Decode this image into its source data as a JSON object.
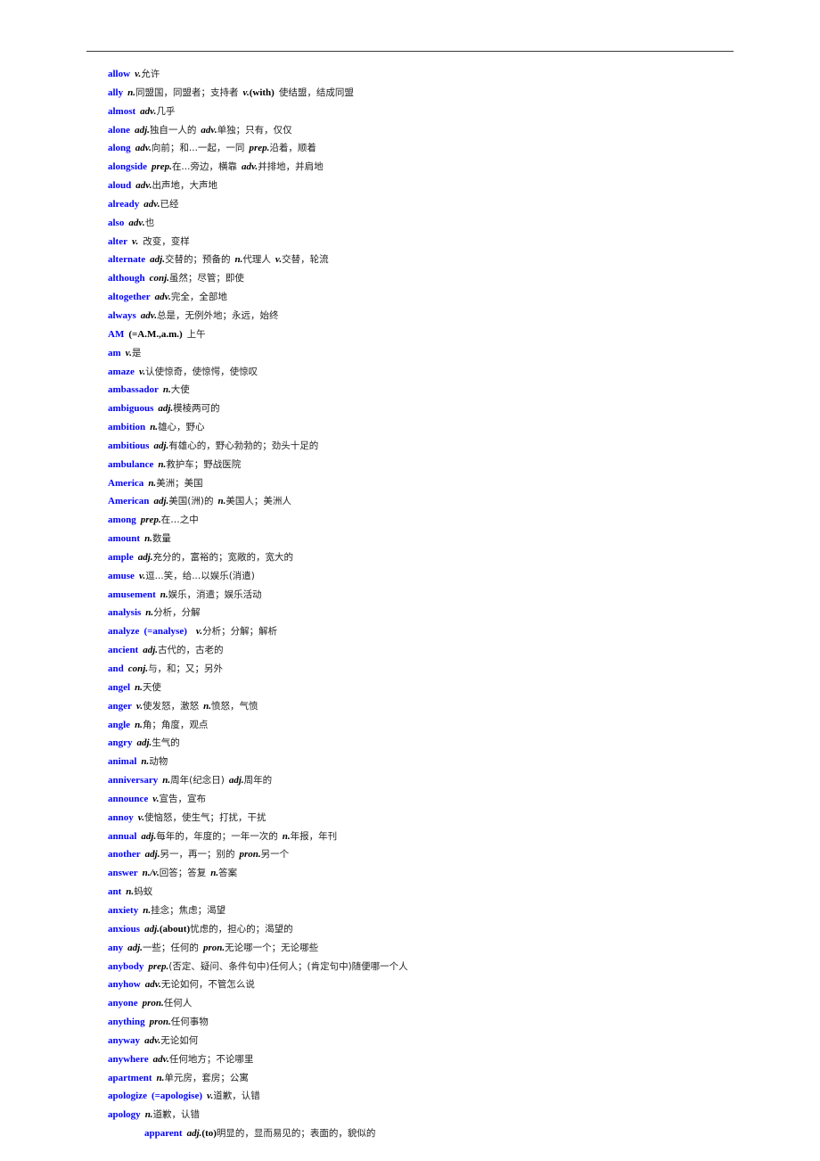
{
  "document": {
    "entries": [
      {
        "word": "allow",
        "parts": [
          {
            "t": "pos",
            "v": "v."
          },
          {
            "t": "def",
            "v": "允许"
          }
        ]
      },
      {
        "word": "ally",
        "parts": [
          {
            "t": "pos",
            "v": "n."
          },
          {
            "t": "def",
            "v": "同盟国，同盟者；支持者"
          },
          {
            "t": "gap"
          },
          {
            "t": "pos",
            "v": "v."
          },
          {
            "t": "note",
            "v": "(with)"
          },
          {
            "t": "gap"
          },
          {
            "t": "def",
            "v": "使结盟，结成同盟"
          }
        ]
      },
      {
        "word": "almost",
        "parts": [
          {
            "t": "pos",
            "v": "adv."
          },
          {
            "t": "def",
            "v": "几乎"
          }
        ]
      },
      {
        "word": "alone",
        "parts": [
          {
            "t": "pos",
            "v": "adj."
          },
          {
            "t": "def",
            "v": "独自一人的"
          },
          {
            "t": "gap"
          },
          {
            "t": "pos",
            "v": "adv."
          },
          {
            "t": "def",
            "v": "单独；只有，仅仅"
          }
        ]
      },
      {
        "word": "along",
        "parts": [
          {
            "t": "pos",
            "v": "adv."
          },
          {
            "t": "def",
            "v": "向前；和...一起，一同"
          },
          {
            "t": "gap"
          },
          {
            "t": "pos",
            "v": "prep."
          },
          {
            "t": "def",
            "v": "沿着，顺着"
          }
        ]
      },
      {
        "word": "alongside",
        "parts": [
          {
            "t": "pos",
            "v": "prep."
          },
          {
            "t": "def",
            "v": "在...旁边，横靠"
          },
          {
            "t": "gap"
          },
          {
            "t": "pos",
            "v": "adv."
          },
          {
            "t": "def",
            "v": "并排地，并肩地"
          }
        ]
      },
      {
        "word": "aloud",
        "parts": [
          {
            "t": "pos",
            "v": "adv."
          },
          {
            "t": "def",
            "v": "出声地，大声地"
          }
        ]
      },
      {
        "word": "already",
        "parts": [
          {
            "t": "pos",
            "v": "adv."
          },
          {
            "t": "def",
            "v": "已经"
          }
        ]
      },
      {
        "word": "also",
        "parts": [
          {
            "t": "pos",
            "v": "adv."
          },
          {
            "t": "def",
            "v": "也"
          }
        ]
      },
      {
        "word": "alter",
        "parts": [
          {
            "t": "pos",
            "v": "v."
          },
          {
            "t": "gap"
          },
          {
            "t": "def",
            "v": "改变，变样"
          }
        ]
      },
      {
        "word": "alternate",
        "parts": [
          {
            "t": "pos",
            "v": "adj."
          },
          {
            "t": "def",
            "v": "交替的；预备的"
          },
          {
            "t": "gap"
          },
          {
            "t": "pos",
            "v": "n."
          },
          {
            "t": "def",
            "v": "代理人"
          },
          {
            "t": "gap"
          },
          {
            "t": "pos",
            "v": "v."
          },
          {
            "t": "def",
            "v": "交替，轮流"
          }
        ]
      },
      {
        "word": "although",
        "parts": [
          {
            "t": "pos",
            "v": "conj."
          },
          {
            "t": "def",
            "v": "虽然；尽管；即使"
          }
        ]
      },
      {
        "word": "altogether",
        "parts": [
          {
            "t": "pos",
            "v": "adv."
          },
          {
            "t": "def",
            "v": "完全，全部地"
          }
        ]
      },
      {
        "word": "always",
        "parts": [
          {
            "t": "pos",
            "v": "adv."
          },
          {
            "t": "def",
            "v": "总是，无例外地；永远，始终"
          }
        ]
      },
      {
        "word": "AM",
        "parts": [
          {
            "t": "note",
            "v": "(=A.M.,a.m.)"
          },
          {
            "t": "gap"
          },
          {
            "t": "def",
            "v": "上午"
          }
        ]
      },
      {
        "word": "am",
        "parts": [
          {
            "t": "pos",
            "v": "v."
          },
          {
            "t": "def",
            "v": "是"
          }
        ]
      },
      {
        "word": "amaze",
        "parts": [
          {
            "t": "pos",
            "v": "v."
          },
          {
            "t": "def",
            "v": "认使惊奇，使惊愕，使惊叹"
          }
        ]
      },
      {
        "word": "ambassador",
        "parts": [
          {
            "t": "pos",
            "v": "n."
          },
          {
            "t": "def",
            "v": "大使"
          }
        ]
      },
      {
        "word": "ambiguous",
        "parts": [
          {
            "t": "pos",
            "v": "adj."
          },
          {
            "t": "def",
            "v": "模棱两可的"
          }
        ]
      },
      {
        "word": "ambition",
        "parts": [
          {
            "t": "pos",
            "v": "n."
          },
          {
            "t": "def",
            "v": "雄心，野心"
          }
        ]
      },
      {
        "word": "ambitious",
        "parts": [
          {
            "t": "pos",
            "v": "adj."
          },
          {
            "t": "def",
            "v": "有雄心的，野心勃勃的；劲头十足的"
          }
        ]
      },
      {
        "word": "ambulance",
        "parts": [
          {
            "t": "pos",
            "v": "n."
          },
          {
            "t": "def",
            "v": "救护车；野战医院"
          }
        ]
      },
      {
        "word": "America",
        "parts": [
          {
            "t": "pos",
            "v": "n."
          },
          {
            "t": "def",
            "v": "美洲；美国"
          }
        ]
      },
      {
        "word": "American",
        "parts": [
          {
            "t": "pos",
            "v": "adj."
          },
          {
            "t": "def",
            "v": "美国(洲)的"
          },
          {
            "t": "gap"
          },
          {
            "t": "pos",
            "v": "n."
          },
          {
            "t": "def",
            "v": "美国人；美洲人"
          }
        ]
      },
      {
        "word": "among",
        "parts": [
          {
            "t": "pos",
            "v": "prep."
          },
          {
            "t": "def",
            "v": "在…之中"
          }
        ]
      },
      {
        "word": "amount",
        "parts": [
          {
            "t": "pos",
            "v": "n."
          },
          {
            "t": "def",
            "v": "数量"
          }
        ]
      },
      {
        "word": "ample",
        "parts": [
          {
            "t": "pos",
            "v": "adj."
          },
          {
            "t": "def",
            "v": "充分的，富裕的；宽敞的，宽大的"
          }
        ]
      },
      {
        "word": "amuse",
        "parts": [
          {
            "t": "pos",
            "v": "v."
          },
          {
            "t": "def",
            "v": "逗...笑，给...以娱乐(消遣)"
          }
        ]
      },
      {
        "word": "amusement",
        "parts": [
          {
            "t": "pos",
            "v": "n."
          },
          {
            "t": "def",
            "v": "娱乐，消遣；娱乐活动"
          }
        ]
      },
      {
        "word": "analysis",
        "parts": [
          {
            "t": "pos",
            "v": "n."
          },
          {
            "t": "def",
            "v": "分析，分解"
          }
        ]
      },
      {
        "word": "analyze",
        "parts": [
          {
            "t": "hwnote",
            "v": "(=analyse)"
          },
          {
            "t": "gap"
          },
          {
            "t": "pos",
            "v": "v."
          },
          {
            "t": "def",
            "v": "分析；分解；解析"
          }
        ]
      },
      {
        "word": "ancient",
        "parts": [
          {
            "t": "pos",
            "v": "adj."
          },
          {
            "t": "def",
            "v": "古代的，古老的"
          }
        ]
      },
      {
        "word": "and",
        "parts": [
          {
            "t": "pos",
            "v": "conj."
          },
          {
            "t": "def",
            "v": "与，和；又；另外"
          }
        ]
      },
      {
        "word": "angel",
        "parts": [
          {
            "t": "pos",
            "v": "n."
          },
          {
            "t": "def",
            "v": "天使"
          }
        ]
      },
      {
        "word": "anger",
        "parts": [
          {
            "t": "pos",
            "v": "v."
          },
          {
            "t": "def",
            "v": "使发怒，激怒"
          },
          {
            "t": "gap"
          },
          {
            "t": "pos",
            "v": "n."
          },
          {
            "t": "def",
            "v": "愤怒，气愤"
          }
        ]
      },
      {
        "word": "angle",
        "parts": [
          {
            "t": "pos",
            "v": "n."
          },
          {
            "t": "def",
            "v": "角；角度，观点"
          }
        ]
      },
      {
        "word": "angry",
        "parts": [
          {
            "t": "pos",
            "v": "adj."
          },
          {
            "t": "def",
            "v": "生气的"
          }
        ]
      },
      {
        "word": "animal",
        "parts": [
          {
            "t": "pos",
            "v": "n."
          },
          {
            "t": "def",
            "v": "动物"
          }
        ]
      },
      {
        "word": "anniversary",
        "parts": [
          {
            "t": "pos",
            "v": "n."
          },
          {
            "t": "def",
            "v": "周年(纪念日)"
          },
          {
            "t": "gap"
          },
          {
            "t": "pos",
            "v": "adj."
          },
          {
            "t": "def",
            "v": "周年的"
          }
        ]
      },
      {
        "word": "announce",
        "parts": [
          {
            "t": "pos",
            "v": "v."
          },
          {
            "t": "def",
            "v": "宣告，宣布"
          }
        ]
      },
      {
        "word": "annoy",
        "parts": [
          {
            "t": "pos",
            "v": "v."
          },
          {
            "t": "def",
            "v": "使恼怒，使生气；打扰，干扰"
          }
        ]
      },
      {
        "word": "annual",
        "parts": [
          {
            "t": "pos",
            "v": "adj."
          },
          {
            "t": "def",
            "v": "每年的，年度的；一年一次的"
          },
          {
            "t": "gap"
          },
          {
            "t": "pos",
            "v": "n."
          },
          {
            "t": "def",
            "v": "年报，年刊"
          }
        ]
      },
      {
        "word": "another",
        "parts": [
          {
            "t": "pos",
            "v": "adj."
          },
          {
            "t": "def",
            "v": "另一，再一；别的"
          },
          {
            "t": "gap"
          },
          {
            "t": "pos",
            "v": "pron."
          },
          {
            "t": "def",
            "v": "另一个"
          }
        ]
      },
      {
        "word": "answer",
        "parts": [
          {
            "t": "pos",
            "v": "n./v."
          },
          {
            "t": "def",
            "v": "回答；答复"
          },
          {
            "t": "gap"
          },
          {
            "t": "pos",
            "v": "n."
          },
          {
            "t": "def",
            "v": "答案"
          }
        ]
      },
      {
        "word": "ant",
        "parts": [
          {
            "t": "pos",
            "v": "n."
          },
          {
            "t": "def",
            "v": "蚂蚁"
          }
        ]
      },
      {
        "word": "anxiety",
        "parts": [
          {
            "t": "pos",
            "v": "n."
          },
          {
            "t": "def",
            "v": "挂念；焦虑；渴望"
          }
        ]
      },
      {
        "word": "anxious",
        "parts": [
          {
            "t": "pos",
            "v": "adj."
          },
          {
            "t": "note",
            "v": "(about)"
          },
          {
            "t": "def",
            "v": "忧虑的，担心的；渴望的"
          }
        ]
      },
      {
        "word": "any",
        "parts": [
          {
            "t": "pos",
            "v": "adj."
          },
          {
            "t": "def",
            "v": "一些；任何的"
          },
          {
            "t": "gap"
          },
          {
            "t": "pos",
            "v": "pron."
          },
          {
            "t": "def",
            "v": "无论哪一个；无论哪些"
          }
        ]
      },
      {
        "word": "anybody",
        "parts": [
          {
            "t": "pos",
            "v": "prep."
          },
          {
            "t": "def",
            "v": "(否定、疑问、条件句中)任何人；(肯定句中)随便哪一个人"
          }
        ]
      },
      {
        "word": "anyhow",
        "parts": [
          {
            "t": "pos",
            "v": "adv."
          },
          {
            "t": "def",
            "v": "无论如何，不管怎么说"
          }
        ]
      },
      {
        "word": "anyone",
        "parts": [
          {
            "t": "pos",
            "v": "pron."
          },
          {
            "t": "def",
            "v": "任何人"
          }
        ]
      },
      {
        "word": "anything",
        "parts": [
          {
            "t": "pos",
            "v": "pron."
          },
          {
            "t": "def",
            "v": "任何事物"
          }
        ]
      },
      {
        "word": "anyway",
        "parts": [
          {
            "t": "pos",
            "v": "adv."
          },
          {
            "t": "def",
            "v": "无论如何"
          }
        ]
      },
      {
        "word": "anywhere",
        "parts": [
          {
            "t": "pos",
            "v": "adv."
          },
          {
            "t": "def",
            "v": "任何地方；不论哪里"
          }
        ]
      },
      {
        "word": "apartment",
        "parts": [
          {
            "t": "pos",
            "v": "n."
          },
          {
            "t": "def",
            "v": "单元房，套房；公寓"
          }
        ]
      },
      {
        "word": "apologize",
        "parts": [
          {
            "t": "hwnote",
            "v": "(=apologise)"
          },
          {
            "t": "pos",
            "v": "v."
          },
          {
            "t": "def",
            "v": "道歉，认错"
          }
        ]
      },
      {
        "word": "apology",
        "parts": [
          {
            "t": "pos",
            "v": "n."
          },
          {
            "t": "def",
            "v": "道歉，认错"
          }
        ]
      }
    ],
    "footer_entry": {
      "word": "apparent",
      "parts": [
        {
          "t": "pos",
          "v": "adj."
        },
        {
          "t": "note",
          "v": "(to)"
        },
        {
          "t": "def",
          "v": "明显的，显而易见的；表面的，貌似的"
        }
      ]
    }
  },
  "colors": {
    "headword": "#0000ff",
    "text": "#000000",
    "rule": "#3a3a3a"
  }
}
